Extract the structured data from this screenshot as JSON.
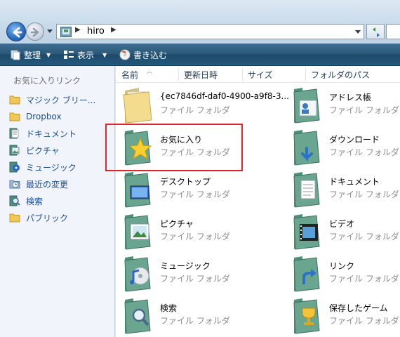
{
  "address": {
    "path_segments": [
      "hiro"
    ]
  },
  "toolbar": {
    "organize_label": "整理",
    "view_label": "表示",
    "burn_label": "書き込む"
  },
  "navpane": {
    "heading": "お気に入りリンク",
    "items": [
      {
        "label": "マジック ブリー...",
        "icon": "folder-icon"
      },
      {
        "label": "Dropbox",
        "icon": "folder-icon"
      },
      {
        "label": "ドキュメント",
        "icon": "documents-icon"
      },
      {
        "label": "ピクチャ",
        "icon": "pictures-icon"
      },
      {
        "label": "ミュージック",
        "icon": "music-icon"
      },
      {
        "label": "最近の変更",
        "icon": "recent-icon"
      },
      {
        "label": "検索",
        "icon": "search-icon"
      },
      {
        "label": "パブリック",
        "icon": "folder-icon"
      }
    ]
  },
  "columns": {
    "name": "名前",
    "modified": "更新日時",
    "size": "サイズ",
    "path": "フォルダのパス"
  },
  "files": [
    {
      "name": "{ec7846df-daf0-4900-a9f8-3...",
      "type": "ファイル フォルダ",
      "icon": "plain-folder-icon"
    },
    {
      "name": "アドレス帳",
      "type": "ファイル フォルダ",
      "icon": "contacts-folder-icon"
    },
    {
      "name": "お気に入り",
      "type": "ファイル フォルダ",
      "icon": "favorites-folder-icon"
    },
    {
      "name": "ダウンロード",
      "type": "ファイル フォルダ",
      "icon": "downloads-folder-icon"
    },
    {
      "name": "デスクトップ",
      "type": "ファイル フォルダ",
      "icon": "desktop-folder-icon"
    },
    {
      "name": "ドキュメント",
      "type": "ファイル フォルダ",
      "icon": "documents-folder-icon"
    },
    {
      "name": "ピクチャ",
      "type": "ファイル フォルダ",
      "icon": "pictures-folder-icon"
    },
    {
      "name": "ビデオ",
      "type": "ファイル フォルダ",
      "icon": "videos-folder-icon"
    },
    {
      "name": "ミュージック",
      "type": "ファイル フォルダ",
      "icon": "music-folder-icon"
    },
    {
      "name": "リンク",
      "type": "ファイル フォルダ",
      "icon": "links-folder-icon"
    },
    {
      "name": "検索",
      "type": "ファイル フォルダ",
      "icon": "searches-folder-icon"
    },
    {
      "name": "保存したゲーム",
      "type": "ファイル フォルダ",
      "icon": "saved-games-folder-icon"
    }
  ],
  "colors": {
    "toolbar": "#2a5878",
    "nav_link": "#1a4e9c",
    "highlight_box": "#e0262c",
    "folder_teal": "#5e9a86"
  }
}
